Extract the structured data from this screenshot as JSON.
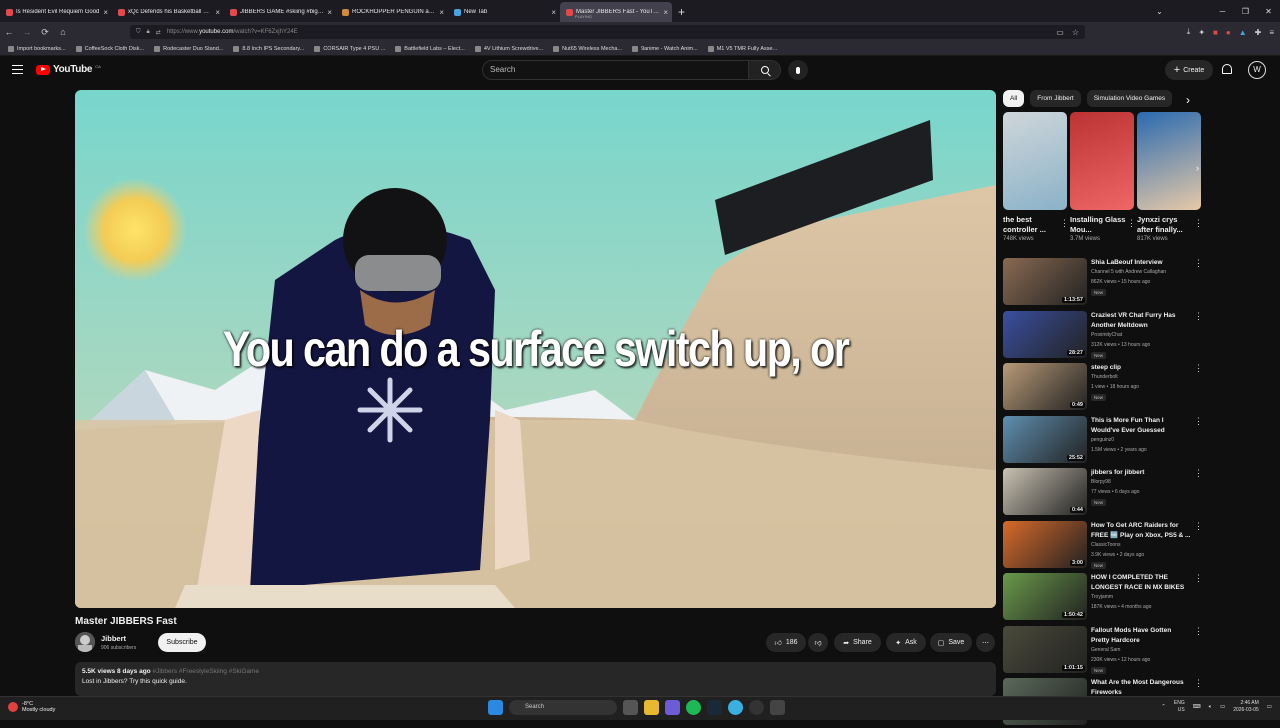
{
  "browser": {
    "tabs": [
      {
        "title": "Is Resident Evil Requiem Good",
        "color": "#e04a4a"
      },
      {
        "title": "xQc Defends his Basketball Skil",
        "color": "#e04a4a"
      },
      {
        "title": "JIBBERS GAME #skiing #bigair",
        "color": "#e04a4a"
      },
      {
        "title": "ROCKHOPPER PENGUIN at Du",
        "color": "#d08a3a"
      },
      {
        "title": "New Tab",
        "color": "#4aa3e0"
      },
      {
        "title": "Master JIBBERS Fast - YouTube",
        "sub": "PLAYING",
        "color": "#e04a4a",
        "active": true
      }
    ],
    "url_prefix": "https://www.",
    "url_domain": "youtube.com",
    "url_rest": "/watch?v=KF6ZxjhY24E",
    "bookmarks": [
      "Import bookmarks...",
      "CoffeeSock Cloth Disk...",
      "Rodecaster Duo Stand...",
      "8.8 Inch IPS Secondary...",
      "CORSAIR Type 4 PSU ...",
      "Battlefield Labs – Elect...",
      "4V Lithium Screwdrive...",
      "Nut65 Wireless Mecha...",
      "9anime - Watch Anim...",
      "M1 V5 TMR Fully Asse..."
    ]
  },
  "youtube": {
    "logo_text": "YouTube",
    "country": "CA",
    "search_placeholder": "Search",
    "create_label": "Create",
    "avatar_letter": "W"
  },
  "video": {
    "caption": "You can do a surface switch up, or",
    "title": "Master JIBBERS Fast",
    "channel": "Jibbert",
    "subscribers": "906 subscribers",
    "subscribe_label": "Subscribe",
    "likes": "186",
    "share_label": "Share",
    "ask_label": "Ask",
    "save_label": "Save",
    "meta": "5.5K views  8 days ago",
    "tags": "#Jibbers #FreestyleSkiing #SkiGame",
    "description": "Lost in Jibbers? Try this quick guide."
  },
  "chips": [
    "All",
    "From Jibbert",
    "Simulation Video Games"
  ],
  "shelf": [
    {
      "title": "the best controller ...",
      "views": "748K views"
    },
    {
      "title": "Installing Glass Mou...",
      "views": "3.7M views"
    },
    {
      "title": "Jynxzi crys after finally...",
      "views": "817K views"
    }
  ],
  "recommendations": [
    {
      "title": "Shia LaBeouf Interview",
      "channel": "Channel 5 with Andrew Callaghan",
      "views": "862K views • 15 hours ago",
      "badge": "New",
      "duration": "1:13:57",
      "thumb": "#8a6a52"
    },
    {
      "title": "Craziest VR Chat Furry Has Another Meltdown",
      "channel": "ProximityChat",
      "views": "312K views • 13 hours ago",
      "badge": "New",
      "duration": "28:27",
      "thumb": "#3a4fa0"
    },
    {
      "title": "steep clip",
      "channel": "Thunderbolt",
      "views": "1 view • 18 hours ago",
      "badge": "New",
      "duration": "0:49",
      "thumb": "#b89a78"
    },
    {
      "title": "This is More Fun Than I Would've Ever Guessed",
      "channel": "penguinz0",
      "views": "1.5M views • 2 years ago",
      "badge": "",
      "duration": "25:52",
      "thumb": "#5f8fb0"
    },
    {
      "title": "jibbers for jibbert",
      "channel": "Blorpy98",
      "views": "77 views • 6 days ago",
      "badge": "New",
      "duration": "0:44",
      "thumb": "#c9c2b2"
    },
    {
      "title": "How To Get ARC Raiders for FREE 🆓 Play on Xbox, PS5 & ...",
      "channel": "ClassicToons",
      "views": "3.9K views • 2 days ago",
      "badge": "New",
      "duration": "3:00",
      "thumb": "#d96a2a"
    },
    {
      "title": "HOW I COMPLETED THE LONGEST RACE IN MX BIKES ...",
      "channel": "Troyjamm",
      "views": "187K views • 4 months ago",
      "badge": "",
      "duration": "1:50:42",
      "thumb": "#6a9a4a"
    },
    {
      "title": "Fallout Mods Have Gotten Pretty Hardcore",
      "channel": "General Sam",
      "views": "230K views • 12 hours ago",
      "badge": "New",
      "duration": "1:01:15",
      "thumb": "#4a4a3a"
    },
    {
      "title": "What Are the Most Dangerous Fireworks",
      "channel": "",
      "views": "",
      "badge": "",
      "duration": "",
      "thumb": "#5a6a5a"
    }
  ],
  "taskbar": {
    "temp": "-8°C",
    "weather": "Mostly cloudy",
    "search": "Search",
    "lang": "ENG",
    "region": "US",
    "time": "2:46 AM",
    "date": "2026-03-05"
  }
}
